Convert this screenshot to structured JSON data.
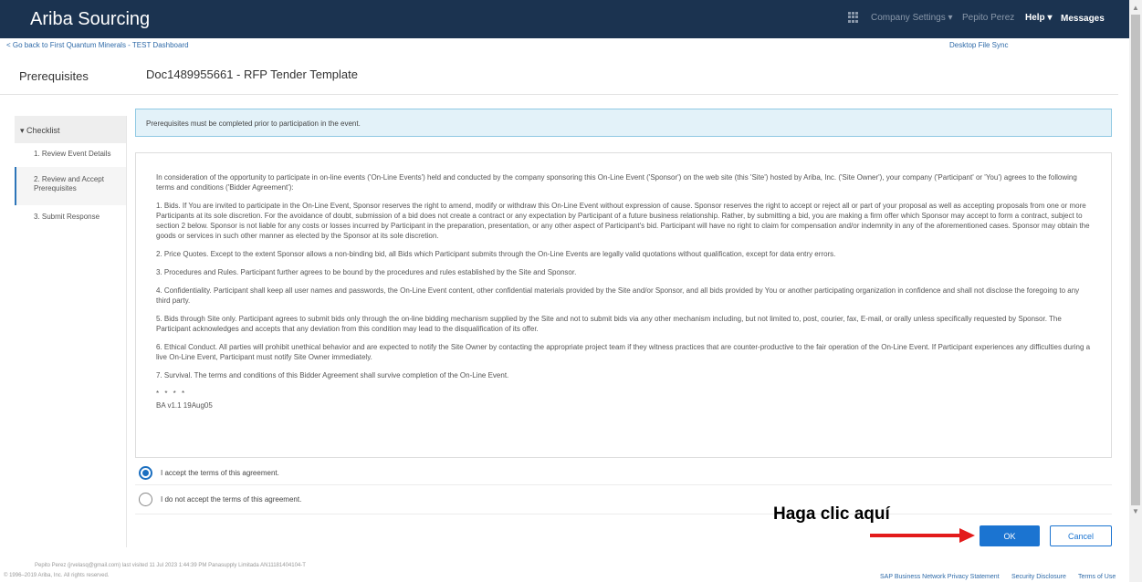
{
  "app": {
    "title": "Ariba Sourcing"
  },
  "topnav": {
    "company_settings": "Company Settings ▾",
    "user": "Pepito Perez",
    "help": "Help ▾",
    "messages": "Messages"
  },
  "subheader": {
    "back_link": "< Go back to First Quantum Minerals - TEST Dashboard",
    "desktop_sync": "Desktop File Sync"
  },
  "page": {
    "section_title": "Prerequisites",
    "doc_title": "Doc1489955661 - RFP Tender Template"
  },
  "sidebar": {
    "checklist": "▾ Checklist",
    "steps": [
      {
        "label": "1.  Review Event Details"
      },
      {
        "label": "2.  Review and Accept Prerequisites"
      },
      {
        "label": "3.  Submit Response"
      }
    ]
  },
  "banner": "Prerequisites must be completed prior to participation in the event.",
  "terms": {
    "intro": "In consideration of the opportunity to participate in on-line events ('On-Line Events') held and conducted by the company sponsoring this On-Line Event ('Sponsor') on the web site (this 'Site') hosted by Ariba, Inc. ('Site Owner'), your company ('Participant' or 'You') agrees to the following terms and conditions ('Bidder Agreement'):",
    "p1": "1. Bids. If You are invited to participate in the On-Line Event, Sponsor reserves the right to amend, modify or withdraw this On-Line Event without expression of cause.  Sponsor reserves the right to accept or reject all or part of your proposal as well as accepting proposals from one or more Participants at its sole discretion. For the avoidance of doubt, submission of a bid does not create a contract or any expectation by Participant of a future business relationship.  Rather, by submitting a bid, you are making a firm offer which Sponsor may accept to form a contract, subject to section 2 below.  Sponsor is not liable for any costs or losses incurred by Participant in the preparation, presentation, or any other aspect of Participant's bid. Participant will have no right to claim for compensation and/or indemnity in any of the aforementioned cases. Sponsor may obtain the goods or services in such other manner as elected by the Sponsor at its sole discretion.",
    "p2": "2. Price Quotes. Except to the extent Sponsor allows a non-binding bid, all Bids which Participant submits through the On-Line Events are legally valid quotations without qualification, except for data entry errors.",
    "p3": "3. Procedures and Rules. Participant further agrees to be bound by the procedures and rules established by the Site and Sponsor.",
    "p4": "4. Confidentiality. Participant shall keep all user names and passwords, the On-Line Event content, other confidential materials provided by the Site and/or Sponsor, and all bids provided by You or another participating organization in confidence and shall not disclose the foregoing to any third party.",
    "p5": "5. Bids through Site only. Participant agrees to submit bids only through the on-line bidding mechanism supplied by the Site and not to submit bids via any other mechanism including, but not limited to, post, courier, fax, E-mail, or orally unless specifically requested by Sponsor. The Participant acknowledges and accepts that any deviation from this condition may lead to the disqualification of its offer.",
    "p6": "6. Ethical Conduct. All parties will prohibit unethical behavior and are expected to notify the Site Owner by contacting the appropriate project team if they witness practices that are counter-productive to the fair operation of the On-Line Event.  If Participant experiences any difficulties during a live On-Line Event, Participant must notify Site Owner immediately.",
    "p7": "7. Survival. The terms and conditions of this Bidder Agreement shall survive completion of the On-Line Event.",
    "stars": "* * * *",
    "version": "BA v1.1 19Aug05"
  },
  "options": {
    "accept": "I accept the terms of this agreement.",
    "decline": "I do not accept the terms of this agreement.",
    "selected": "accept"
  },
  "actions": {
    "callout": "Haga clic aquí",
    "ok": "OK",
    "cancel": "Cancel",
    "callout_color": "#e31b1b"
  },
  "footer": {
    "user_info": "Pepito Perez (jrvelasq@gmail.com) last visited 11 Jul 2023 1:44:39 PM  Panasupply Limitada  AN11181404104-T",
    "copyright": "© 1996–2019 Ariba, Inc. All rights reserved.",
    "privacy": "SAP Business Network Privacy Statement",
    "security": "Security Disclosure",
    "terms": "Terms of Use"
  },
  "colors": {
    "topbar": "#1b3350",
    "primary": "#1b74d1",
    "link": "#2e6aa8",
    "banner_bg": "#e3f2f9"
  }
}
